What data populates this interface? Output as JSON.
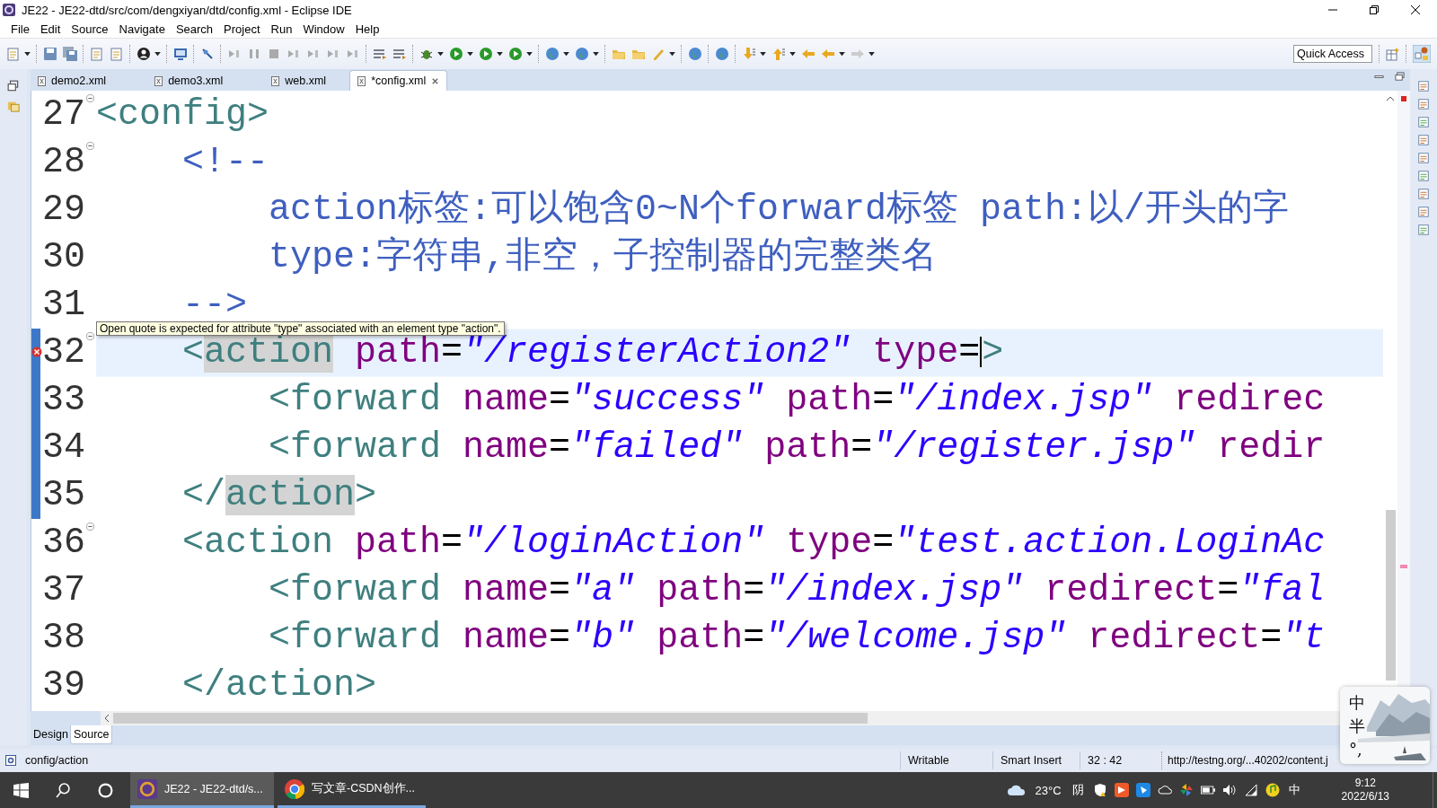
{
  "window": {
    "title": "JE22 - JE22-dtd/src/com/dengxiyan/dtd/config.xml - Eclipse IDE"
  },
  "menu": [
    "File",
    "Edit",
    "Source",
    "Navigate",
    "Search",
    "Project",
    "Run",
    "Window",
    "Help"
  ],
  "quick_access": {
    "placeholder": "Quick Access"
  },
  "editor_tabs": [
    {
      "label": "demo2.xml",
      "selected": false
    },
    {
      "label": "demo3.xml",
      "selected": false
    },
    {
      "label": "web.xml",
      "selected": false
    },
    {
      "label": "*config.xml",
      "selected": true
    }
  ],
  "code_lines": [
    {
      "number": "27",
      "fold": true,
      "current": false,
      "error": false,
      "range": false,
      "tokens": [
        {
          "kind": "tag",
          "text": "<config>"
        }
      ]
    },
    {
      "number": "28",
      "fold": true,
      "current": false,
      "error": false,
      "range": false,
      "tokens": [
        {
          "kind": "comment",
          "text": "    <!--"
        }
      ]
    },
    {
      "number": "29",
      "fold": false,
      "current": false,
      "error": false,
      "range": false,
      "tokens": [
        {
          "kind": "comment",
          "text": "        action标签:可以饱含0~N个forward标签 path:以/开头的字"
        }
      ]
    },
    {
      "number": "30",
      "fold": false,
      "current": false,
      "error": false,
      "range": false,
      "tokens": [
        {
          "kind": "comment",
          "text": "        type:字符串,非空，子控制器的完整类名"
        }
      ]
    },
    {
      "number": "31",
      "fold": false,
      "current": false,
      "error": false,
      "range": false,
      "tokens": [
        {
          "kind": "comment",
          "text": "    -->"
        }
      ]
    },
    {
      "number": "32",
      "fold": true,
      "current": true,
      "error": true,
      "range": true,
      "tokens": [
        {
          "kind": "tag",
          "text": "    <"
        },
        {
          "kind": "tag_match",
          "text": "action"
        },
        {
          "kind": "attr",
          "text": " path"
        },
        {
          "kind": "plain",
          "text": "="
        },
        {
          "kind": "string",
          "text": "\"/registerAction2\""
        },
        {
          "kind": "attr",
          "text": " type"
        },
        {
          "kind": "plain",
          "text": "="
        },
        {
          "kind": "caret"
        },
        {
          "kind": "tag",
          "text": ">"
        }
      ]
    },
    {
      "number": "33",
      "fold": false,
      "current": false,
      "error": false,
      "range": true,
      "tokens": [
        {
          "kind": "tag",
          "text": "        <forward"
        },
        {
          "kind": "attr",
          "text": " name"
        },
        {
          "kind": "plain",
          "text": "="
        },
        {
          "kind": "string",
          "text": "\"success\""
        },
        {
          "kind": "attr",
          "text": " path"
        },
        {
          "kind": "plain",
          "text": "="
        },
        {
          "kind": "string",
          "text": "\"/index.jsp\""
        },
        {
          "kind": "attr",
          "text": " redirec"
        }
      ]
    },
    {
      "number": "34",
      "fold": false,
      "current": false,
      "error": false,
      "range": true,
      "tokens": [
        {
          "kind": "tag",
          "text": "        <forward"
        },
        {
          "kind": "attr",
          "text": " name"
        },
        {
          "kind": "plain",
          "text": "="
        },
        {
          "kind": "string",
          "text": "\"failed\""
        },
        {
          "kind": "attr",
          "text": " path"
        },
        {
          "kind": "plain",
          "text": "="
        },
        {
          "kind": "string",
          "text": "\"/register.jsp\""
        },
        {
          "kind": "attr",
          "text": " redir"
        }
      ]
    },
    {
      "number": "35",
      "fold": false,
      "current": false,
      "error": false,
      "range": true,
      "tokens": [
        {
          "kind": "tag",
          "text": "    </"
        },
        {
          "kind": "tag_match",
          "text": "action"
        },
        {
          "kind": "tag",
          "text": ">"
        }
      ]
    },
    {
      "number": "36",
      "fold": true,
      "current": false,
      "error": false,
      "range": false,
      "tokens": [
        {
          "kind": "tag",
          "text": "    <action"
        },
        {
          "kind": "attr",
          "text": " path"
        },
        {
          "kind": "plain",
          "text": "="
        },
        {
          "kind": "string",
          "text": "\"/loginAction\""
        },
        {
          "kind": "attr",
          "text": " type"
        },
        {
          "kind": "plain",
          "text": "="
        },
        {
          "kind": "string",
          "text": "\"test.action.LoginAc"
        }
      ]
    },
    {
      "number": "37",
      "fold": false,
      "current": false,
      "error": false,
      "range": false,
      "tokens": [
        {
          "kind": "tag",
          "text": "        <forward"
        },
        {
          "kind": "attr",
          "text": " name"
        },
        {
          "kind": "plain",
          "text": "="
        },
        {
          "kind": "string",
          "text": "\"a\""
        },
        {
          "kind": "attr",
          "text": " path"
        },
        {
          "kind": "plain",
          "text": "="
        },
        {
          "kind": "string",
          "text": "\"/index.jsp\""
        },
        {
          "kind": "attr",
          "text": " redirect"
        },
        {
          "kind": "plain",
          "text": "="
        },
        {
          "kind": "string",
          "text": "\"fal"
        }
      ]
    },
    {
      "number": "38",
      "fold": false,
      "current": false,
      "error": false,
      "range": false,
      "tokens": [
        {
          "kind": "tag",
          "text": "        <forward"
        },
        {
          "kind": "attr",
          "text": " name"
        },
        {
          "kind": "plain",
          "text": "="
        },
        {
          "kind": "string",
          "text": "\"b\""
        },
        {
          "kind": "attr",
          "text": " path"
        },
        {
          "kind": "plain",
          "text": "="
        },
        {
          "kind": "string",
          "text": "\"/welcome.jsp\""
        },
        {
          "kind": "attr",
          "text": " redirect"
        },
        {
          "kind": "plain",
          "text": "="
        },
        {
          "kind": "string",
          "text": "\"t"
        }
      ]
    },
    {
      "number": "39",
      "fold": false,
      "current": false,
      "error": false,
      "range": false,
      "tokens": [
        {
          "kind": "tag",
          "text": "    </action>"
        }
      ]
    }
  ],
  "tooltip": {
    "text": "Open quote is expected for attribute \"type\" associated with an element type \"action\"."
  },
  "bottom_tabs": [
    {
      "label": "Design",
      "selected": false
    },
    {
      "label": "Source",
      "selected": true
    }
  ],
  "status_bar": {
    "breadcrumb": "config/action",
    "mode": "Writable",
    "insert_mode": "Smart Insert",
    "position": "32 : 42",
    "url": "http://testng.org/...40202/content.j"
  },
  "ime_widget": {
    "indicators": [
      "中",
      "半",
      "°,"
    ]
  },
  "taskbar": {
    "tasks": [
      {
        "label": "JE22 - JE22-dtd/s...",
        "kind": "eclipse",
        "selected": true
      },
      {
        "label": "写文章-CSDN创作...",
        "kind": "browser",
        "selected": false
      }
    ],
    "temperature": "23°C",
    "weather": "阴",
    "input_method": "中",
    "time": "9:12",
    "date": "2022/6/13"
  }
}
